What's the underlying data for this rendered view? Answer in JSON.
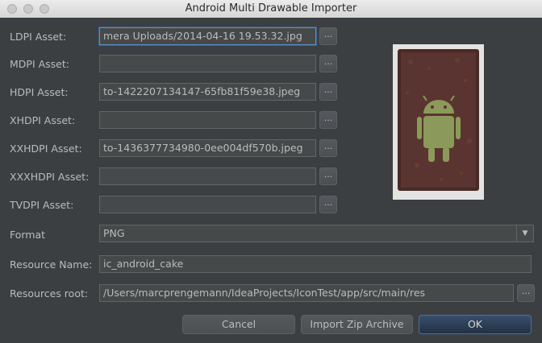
{
  "window": {
    "title": "Android Multi Drawable Importer"
  },
  "assets": [
    {
      "label": "LDPI Asset:",
      "value": "mera Uploads/2014-04-16 19.53.32.jpg",
      "browse": "..."
    },
    {
      "label": "MDPI Asset:",
      "value": "",
      "browse": "..."
    },
    {
      "label": "HDPI Asset:",
      "value": "to-1422207134147-65fb81f59e38.jpeg",
      "browse": "..."
    },
    {
      "label": "XHDPI Asset:",
      "value": "",
      "browse": "..."
    },
    {
      "label": "XXHDPI Asset:",
      "value": "to-1436377734980-0ee004df570b.jpeg",
      "browse": "..."
    },
    {
      "label": "XXXHDPI Asset:",
      "value": "",
      "browse": "..."
    },
    {
      "label": "TVDPI Asset:",
      "value": "",
      "browse": "..."
    }
  ],
  "format": {
    "label": "Format",
    "value": "PNG",
    "arrow_icon": "triangle-down"
  },
  "resource_name": {
    "label": "Resource Name:",
    "value": "ic_android_cake"
  },
  "resources_root": {
    "label": "Resources root:",
    "value": "/Users/marcprengemann/IdeaProjects/IconTest/app/src/main/res",
    "browse": "..."
  },
  "buttons": {
    "cancel": "Cancel",
    "import_zip": "Import Zip Archive",
    "ok": "OK"
  },
  "colors": {
    "background": "#3c3f41",
    "field": "#45494a",
    "focus": "#5a8ed1",
    "ok_button": "#2f4560"
  }
}
